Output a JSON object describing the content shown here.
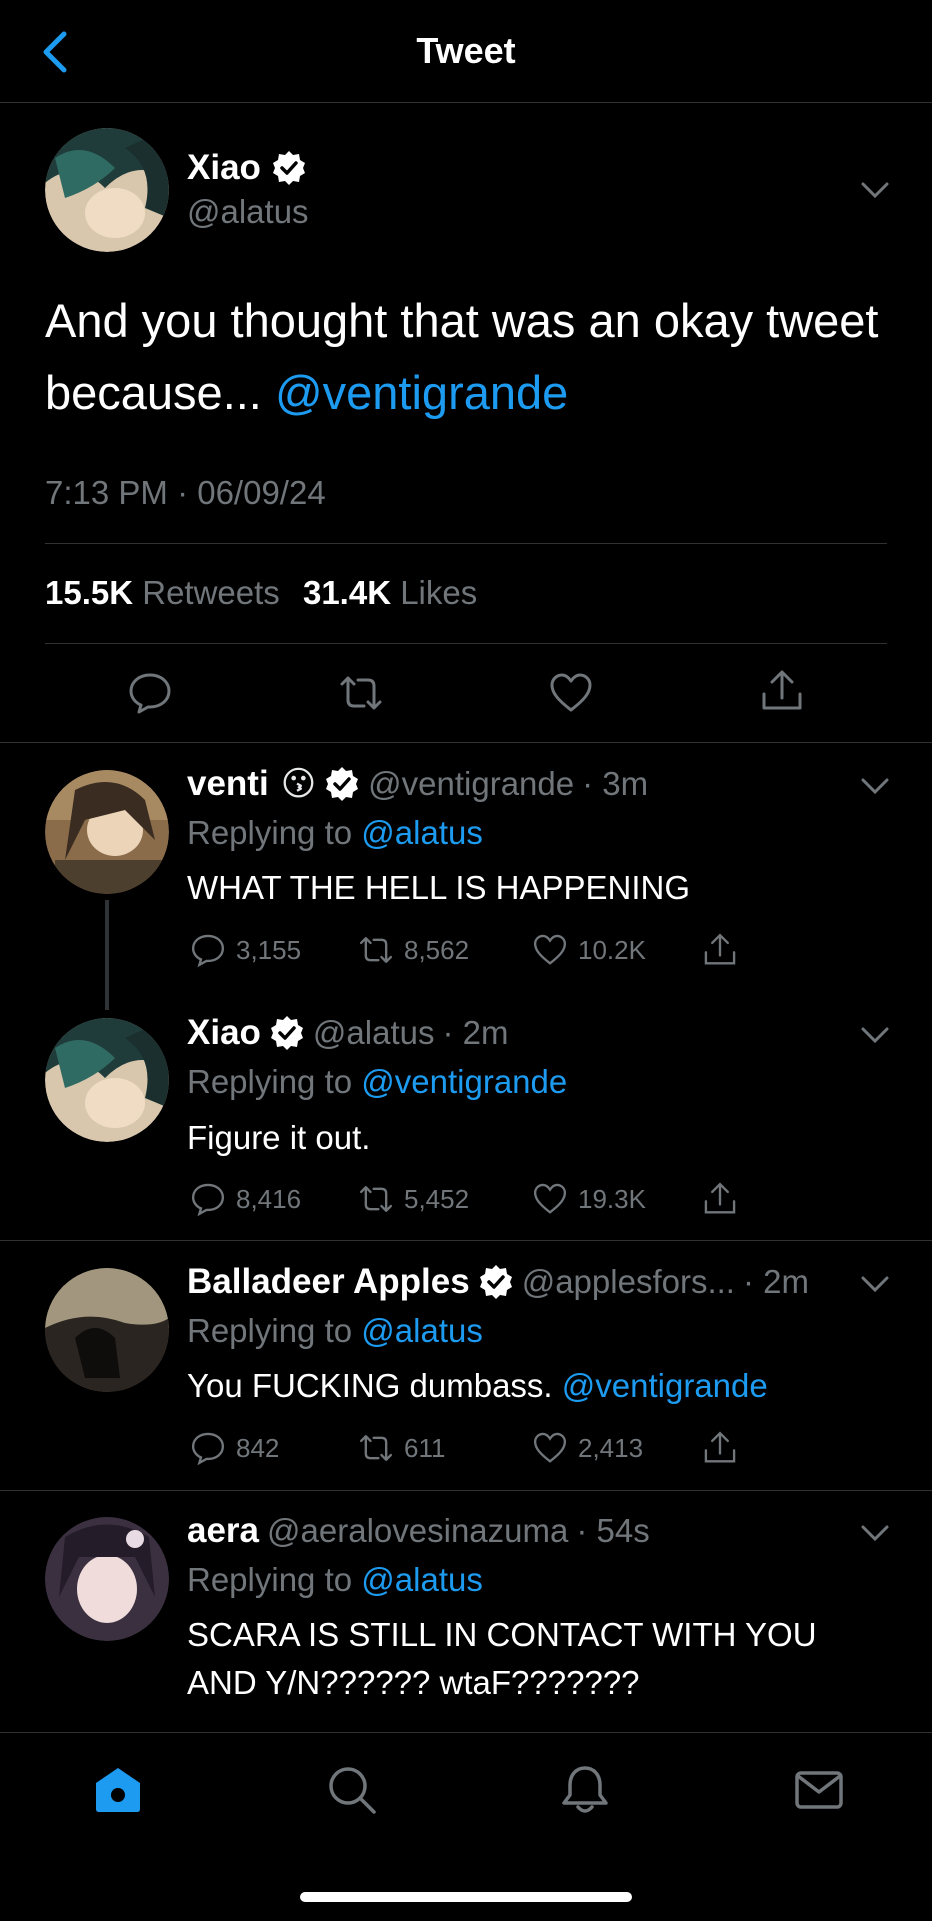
{
  "header": {
    "title": "Tweet",
    "back_icon": "chevron-left-icon"
  },
  "main_tweet": {
    "name": "Xiao",
    "handle": "@alatus",
    "text_plain": "And you thought that was an okay tweet because... ",
    "text_mention": "@ventigrande",
    "time": "7:13 PM · 06/09/24",
    "retweets_count": "15.5K",
    "retweets_label": "Retweets",
    "likes_count": "31.4K",
    "likes_label": "Likes"
  },
  "replies": [
    {
      "name": "venti",
      "emoji": "😗",
      "handle": "@ventigrande",
      "time": "· 3m",
      "replying_label": "Replying to",
      "replying_to": "@alatus",
      "text": "WHAT THE HELL IS HAPPENING",
      "reply_count": "3,155",
      "retweet_count": "8,562",
      "like_count": "10.2K"
    },
    {
      "name": "Xiao",
      "handle": "@alatus",
      "time": "· 2m",
      "replying_label": "Replying to",
      "replying_to": "@ventigrande",
      "text": "Figure it out.",
      "reply_count": "8,416",
      "retweet_count": "5,452",
      "like_count": "19.3K"
    },
    {
      "name": "Balladeer Apples",
      "handle": "@applesfors...",
      "time": "· 2m",
      "replying_label": "Replying to",
      "replying_to": "@alatus",
      "text": "You FUCKING dumbass. ",
      "text_mention": "@ventigrande",
      "reply_count": "842",
      "retweet_count": "611",
      "like_count": "2,413"
    },
    {
      "name": "aera",
      "handle": "@aeralovesinazuma",
      "time": "· 54s",
      "replying_label": "Replying to",
      "replying_to": "@alatus",
      "text_line1": "SCARA IS STILL IN CONTACT WITH YOU",
      "text_line2": "AND Y/N?????? wtaF???????"
    }
  ],
  "nav": {
    "items": [
      "home-icon",
      "search-icon",
      "notifications-icon",
      "messages-icon"
    ],
    "active": "home-icon"
  },
  "colors": {
    "accent": "#1d9bf0",
    "muted": "#71767b",
    "background": "#000000"
  }
}
